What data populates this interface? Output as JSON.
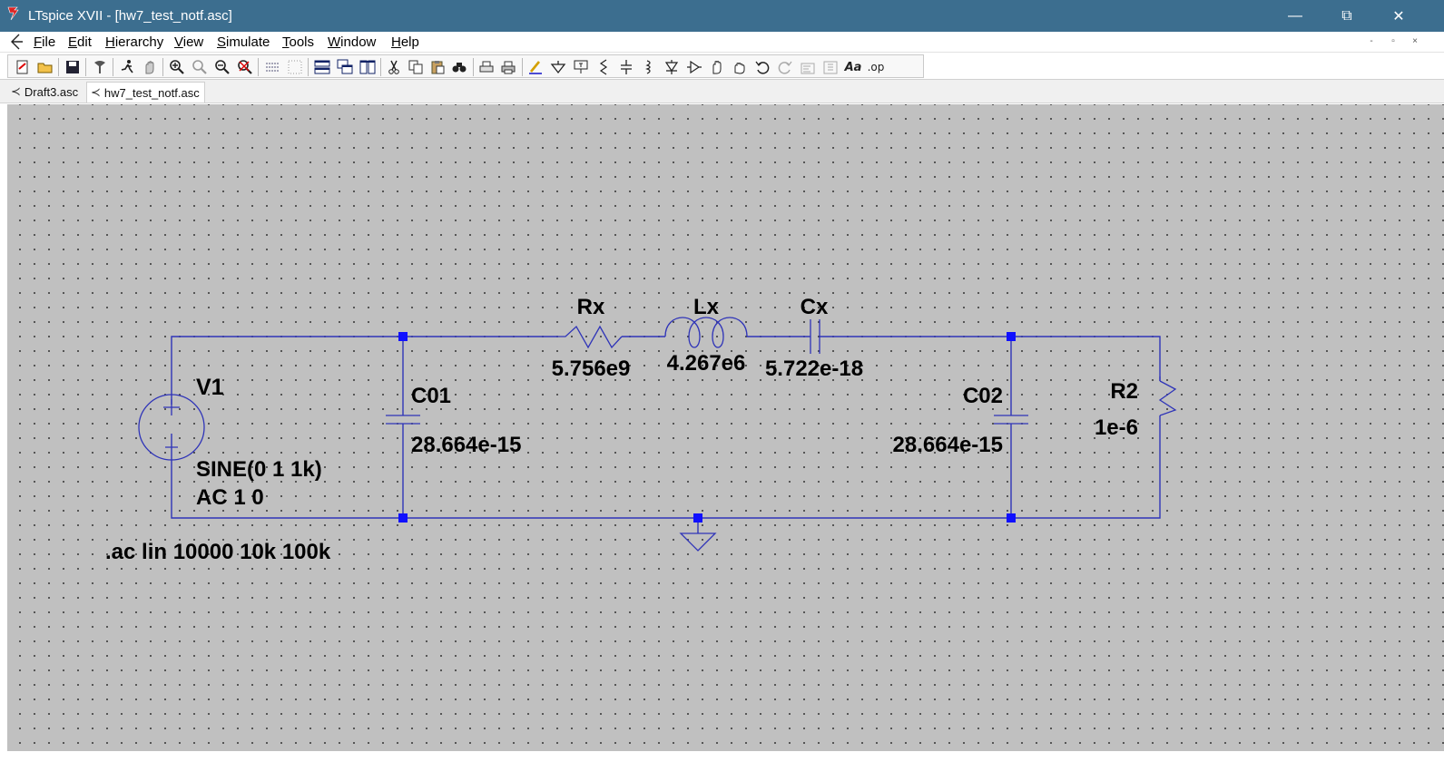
{
  "window": {
    "title": "LTspice XVII - [hw7_test_notf.asc]",
    "controls": {
      "minimize": "—",
      "restore": "⧉",
      "close": "✕"
    }
  },
  "menu": {
    "items": [
      "File",
      "Edit",
      "Hierarchy",
      "View",
      "Simulate",
      "Tools",
      "Window",
      "Help"
    ],
    "mdi_controls": {
      "minimize": "-",
      "restore": "▫",
      "close": "×"
    }
  },
  "toolbar": {
    "icons": [
      "new-schematic-icon",
      "open-icon",
      "save-icon",
      "control-panel-icon",
      "run-icon",
      "halt-icon",
      "zoom-in-icon",
      "zoom-pan-icon",
      "zoom-out-icon",
      "zoom-fit-icon",
      "autorange-icon",
      "grid-icon",
      "tile-horizontal-icon",
      "cascade-icon",
      "tile-vertical-icon",
      "cut-icon",
      "copy-icon",
      "paste-icon",
      "find-icon",
      "print-setup-icon",
      "print-icon",
      "draw-wire-icon",
      "ground-icon",
      "label-net-icon",
      "resistor-icon",
      "capacitor-icon",
      "inductor-icon",
      "diode-icon",
      "component-icon",
      "move-icon",
      "drag-icon",
      "undo-icon",
      "redo-icon",
      "rotate-icon",
      "mirror-icon",
      "text-icon",
      "spice-directive-icon"
    ],
    "text_glyphs": {
      "text_tool": "Aa",
      "spice_directive": ".op"
    }
  },
  "tabs": [
    {
      "label": "Draft3.asc",
      "active": false
    },
    {
      "label": "hw7_test_notf.asc",
      "active": true
    }
  ],
  "schematic": {
    "V1": {
      "name": "V1",
      "value_line1": "SINE(0 1 1k)",
      "value_line2": "AC 1 0"
    },
    "C01": {
      "name": "C01",
      "value": "28.664e-15"
    },
    "Rx": {
      "name": "Rx",
      "value": "5.756e9"
    },
    "Lx": {
      "name": "Lx",
      "value": "4.267e6"
    },
    "Cx": {
      "name": "Cx",
      "value": "5.722e-18"
    },
    "C02": {
      "name": "C02",
      "value": "28.664e-15"
    },
    "R2": {
      "name": "R2",
      "value": "1e-6"
    },
    "directive": ".ac lin 10000 10k 100k",
    "colors": {
      "wire": "#2f34b8",
      "junction": "#1010ff",
      "background": "#c0c0c0",
      "grid_dot": "#3a3a3a"
    }
  }
}
